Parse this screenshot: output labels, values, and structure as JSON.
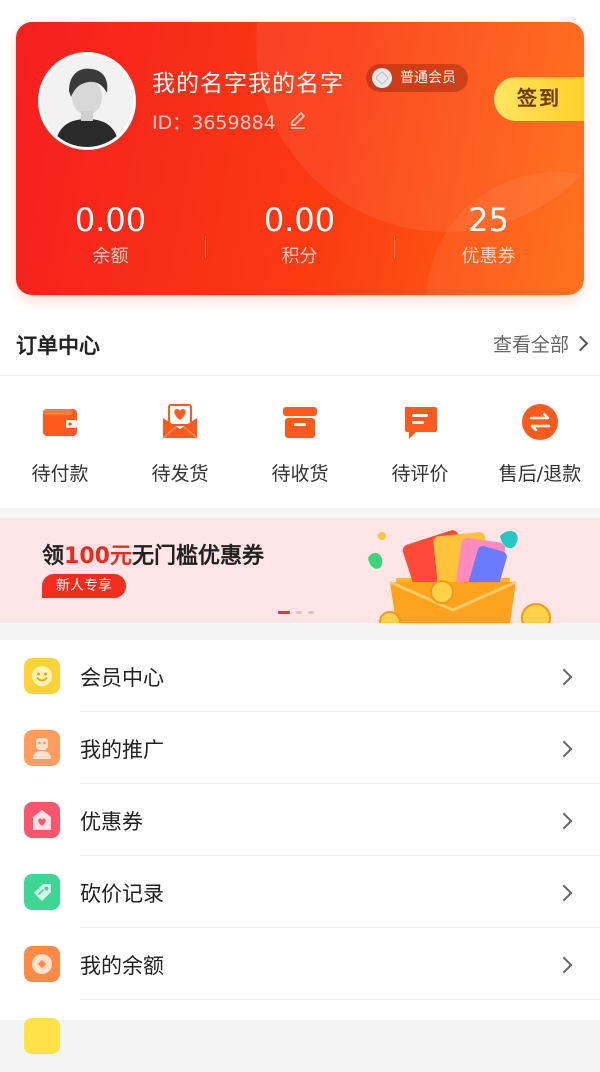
{
  "profile": {
    "username": "我的名字我的名字",
    "member_level": "普通会员",
    "user_id": "ID：3659884",
    "checkin_label": "签到",
    "stats": [
      {
        "value": "0.00",
        "label": "余额"
      },
      {
        "value": "0.00",
        "label": "积分"
      },
      {
        "value": "25",
        "label": "优惠券"
      }
    ]
  },
  "orders": {
    "title": "订单中心",
    "view_all": "查看全部",
    "items": [
      {
        "label": "待付款",
        "icon": "wallet-icon"
      },
      {
        "label": "待发货",
        "icon": "heart-envelope-icon"
      },
      {
        "label": "待收货",
        "icon": "box-icon"
      },
      {
        "label": "待评价",
        "icon": "comment-icon"
      },
      {
        "label": "售后/退款",
        "icon": "exchange-icon"
      }
    ]
  },
  "banner": {
    "text_prefix": "领",
    "amount": "100元",
    "text_suffix": "无门槛优惠券",
    "tag": "新人专享",
    "active_slide": 1,
    "total_slides": 3
  },
  "menu": {
    "items": [
      {
        "label": "会员中心",
        "icon": "smile-icon",
        "color": "#ffd338"
      },
      {
        "label": "我的推广",
        "icon": "person-icon",
        "color": "#ff9d5e"
      },
      {
        "label": "优惠券",
        "icon": "coupon-heart-icon",
        "color": "#f9566e"
      },
      {
        "label": "砍价记录",
        "icon": "tag-icon",
        "color": "#3dd692"
      },
      {
        "label": "我的余额",
        "icon": "coin-icon",
        "color": "#ff8a46"
      }
    ]
  },
  "colors": {
    "card_start": "#f41f1f",
    "card_end": "#ff6a10",
    "accent_orange": "#ff5a1e",
    "checkin_yellow": "#ffcc24",
    "banner_red": "#ee2a1f"
  }
}
